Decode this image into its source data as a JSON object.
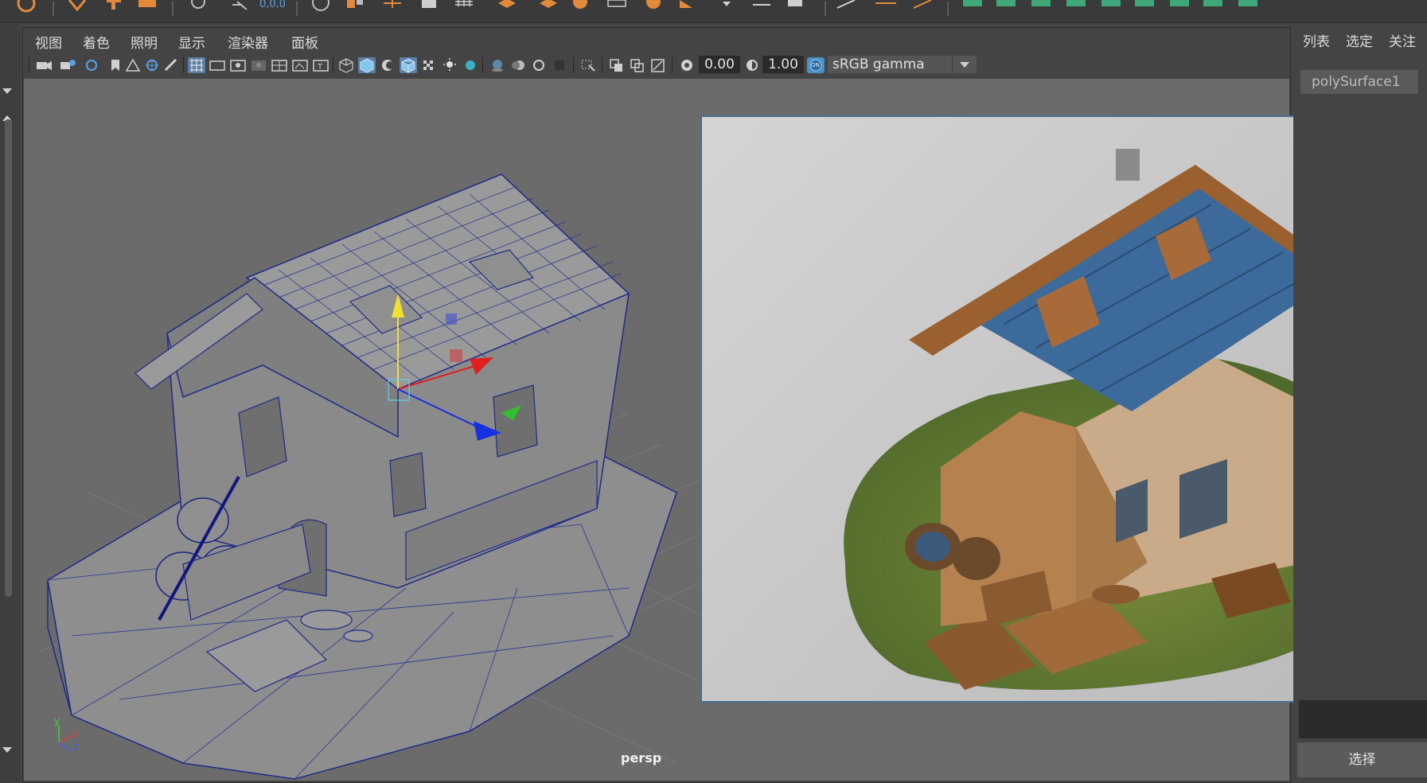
{
  "shelf": {
    "coord_readout": "0,0,0"
  },
  "menu": {
    "items": [
      "视图",
      "着色",
      "照明",
      "显示",
      "渲染器",
      "面板"
    ]
  },
  "toolbar": {
    "exposure": "0.00",
    "gamma": "1.00",
    "color_space": "sRGB gamma",
    "on_badge": "ON"
  },
  "viewport": {
    "camera_label": "persp",
    "axis_x": "x",
    "axis_y": "y",
    "axis_z": "z"
  },
  "right_panel": {
    "menu": [
      "列表",
      "选定",
      "关注"
    ],
    "object_name": "polySurface1",
    "select_button": "选择"
  },
  "colors": {
    "accent": "#4a90c9",
    "panel_bg": "#444444",
    "viewport_bg": "#6b6b6b",
    "wire": "#1e2a88"
  }
}
